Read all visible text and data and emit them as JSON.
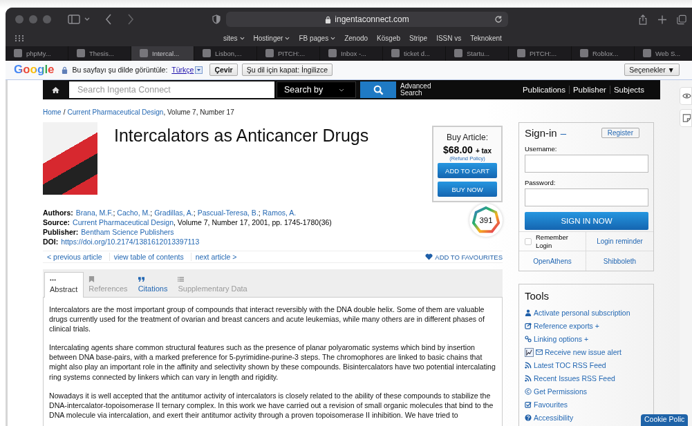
{
  "browser": {
    "address": "ingentaconnect.com",
    "bookmarks": [
      {
        "label": "sites",
        "menu": true
      },
      {
        "label": "Hostinger",
        "menu": true
      },
      {
        "label": "FB pages",
        "menu": true
      },
      {
        "label": "Zenodo",
        "menu": false
      },
      {
        "label": "Kösgeb",
        "menu": false
      },
      {
        "label": "Stripe",
        "menu": false
      },
      {
        "label": "ISSN vs",
        "menu": false
      },
      {
        "label": "Teknokent",
        "menu": false
      }
    ],
    "tabs": [
      {
        "label": "phpMy...",
        "selected": false
      },
      {
        "label": "Thesis...",
        "selected": false
      },
      {
        "label": "Intercal...",
        "selected": true
      },
      {
        "label": "Lisbon,...",
        "selected": false
      },
      {
        "label": "PITCH:...",
        "selected": false
      },
      {
        "label": "Inbox -...",
        "selected": false
      },
      {
        "label": "ticket d...",
        "selected": false
      },
      {
        "label": "Startu...",
        "selected": false
      },
      {
        "label": "PITCH:...",
        "selected": false
      },
      {
        "label": "Roblox...",
        "selected": false
      },
      {
        "label": "Web S...",
        "selected": false
      }
    ]
  },
  "translate_bar": {
    "logo": "Google",
    "prompt": "Bu sayfayı şu dilde görüntüle:",
    "language": "Türkçe",
    "translate_button": "Çevir",
    "never_button": "Şu dil için kapat: İngilizce",
    "options_button": "Seçenekler ▼"
  },
  "nav": {
    "search": {
      "placeholder": "Search Ingenta Connect"
    },
    "search_by": "Search by",
    "advanced_search": "Advanced Search",
    "links": [
      "Publications",
      "Publisher",
      "Subjects"
    ]
  },
  "breadcrumb": [
    {
      "text": "Home",
      "kind": "link"
    },
    {
      "text": "/",
      "kind": "text"
    },
    {
      "text": "Current Pharmaceutical Design",
      "kind": "link"
    },
    {
      "text": ", Volume 7, Number 17",
      "kind": "text"
    }
  ],
  "article": {
    "title": "Intercalators as Anticancer Drugs",
    "meta": [
      {
        "label": "Authors:",
        "parts": [
          {
            "text": "Brana, M.F.",
            "kind": "link"
          },
          {
            "text": ";",
            "kind": "text"
          },
          {
            "text": "Cacho, M.",
            "kind": "link"
          },
          {
            "text": ";",
            "kind": "text"
          },
          {
            "text": "Gradillas, A.",
            "kind": "link"
          },
          {
            "text": ";",
            "kind": "text"
          },
          {
            "text": "Pascual-Teresa, B.",
            "kind": "link"
          },
          {
            "text": ";",
            "kind": "text"
          },
          {
            "text": "Ramos, A.",
            "kind": "link"
          }
        ]
      },
      {
        "label": "Source:",
        "parts": [
          {
            "text": "Current Pharmaceutical Design",
            "kind": "link"
          },
          {
            "text": ", Volume 7, Number 17, 2001, pp. 1745-1780(36)",
            "kind": "text"
          }
        ]
      },
      {
        "label": "Publisher:",
        "parts": [
          {
            "text": "Bentham Science Publishers",
            "kind": "link"
          }
        ]
      },
      {
        "label": "DOI:",
        "parts": [
          {
            "text": "https://doi.org/10.2174/1381612013397113",
            "kind": "link"
          }
        ]
      }
    ],
    "citation_badge": "391"
  },
  "buy": {
    "heading": "Buy Article:",
    "price": "$68.00",
    "tax": "+ tax",
    "refund": "(Refund Policy)",
    "buttons": [
      "ADD TO CART",
      "BUY NOW"
    ]
  },
  "article_nav": {
    "links": [
      "< previous article",
      "view table of contents",
      "next article >"
    ],
    "favourites": "ADD TO FAVOURITES"
  },
  "content_tabs": [
    {
      "label": "Abstract",
      "kind": "dots",
      "selected": true,
      "disabled": false
    },
    {
      "label": "References",
      "kind": "bookmark",
      "selected": false,
      "disabled": true
    },
    {
      "label": "Citations",
      "kind": "quote",
      "selected": false,
      "disabled": false
    },
    {
      "label": "Supplementary Data",
      "kind": "list",
      "selected": false,
      "disabled": true
    }
  ],
  "abstract": [
    "Intercalators are the most important group of compounds that interact reversibly with the DNA double helix. Some of them are valuable drugs currently used for the treatment of ovarian and breast cancers and acute leukemias, while many others are in different phases of clinical trials.",
    "Intercalating agents share common structural features such as the presence of planar polyaromatic systems which bind by insertion between DNA base-pairs, with a marked preference for 5-pyrimidine-purine-3 steps. The chromophores are linked to basic chains that might also play an important role in the affinity and selectivity shown by these compounds. Bisintercalators have two potential intercalating ring systems connected by linkers which can vary in length and rigidity.",
    "Nowadays it is well accepted that the antitumor activity of intercalators is closely related to the ability of these compounds to stabilize the DNA-intercalator-topoisomerase II ternary complex. In this work we have carried out a revision of small organic molecules that bind to the DNA molecule via intercalation, and exert their antitumor activity through a proven topoisomerase II inhibition. We have tried to"
  ],
  "sign_in": {
    "title": "Sign-in",
    "dash": "–",
    "register": "Register",
    "username_label": "Username:",
    "password_label": "Password:",
    "submit": "SIGN IN NOW",
    "remember": {
      "label": "Remember Login",
      "checked": false
    },
    "links": [
      "Login reminder",
      "OpenAthens",
      "Shibboleth"
    ]
  },
  "tools": {
    "title": "Tools",
    "items": [
      {
        "label": "Activate personal subscription",
        "kind": "user"
      },
      {
        "label": "Reference exports +",
        "kind": "export"
      },
      {
        "label": "Linking options +",
        "kind": "link"
      },
      {
        "label": "Receive new issue alert",
        "kind": "alert"
      },
      {
        "label": "Latest TOC RSS Feed",
        "kind": "rss"
      },
      {
        "label": "Recent Issues RSS Feed",
        "kind": "rss"
      },
      {
        "label": "Get Permissions",
        "kind": "copyright"
      },
      {
        "label": "Favourites",
        "kind": "check"
      },
      {
        "label": "Accessibility",
        "kind": "help"
      }
    ]
  },
  "cookie_button": "Cookie Polic"
}
